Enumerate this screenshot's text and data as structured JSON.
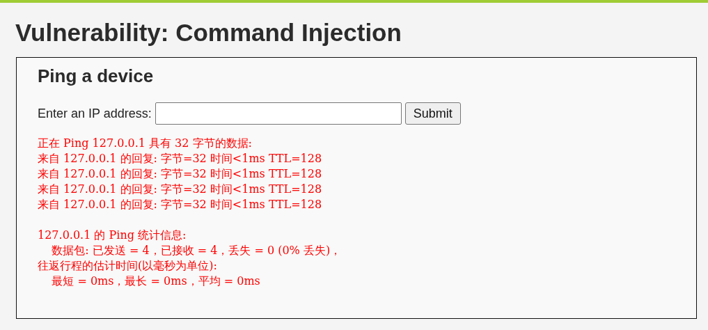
{
  "page": {
    "title": "Vulnerability: Command Injection"
  },
  "panel": {
    "heading": "Ping a device",
    "form": {
      "label": "Enter an IP address:",
      "submit": "Submit"
    },
    "output_blocks": [
      [
        "正在 Ping 127.0.0.1 具有 32 字节的数据:",
        "来自 127.0.0.1 的回复: 字节=32 时间<1ms TTL=128",
        "来自 127.0.0.1 的回复: 字节=32 时间<1ms TTL=128",
        "来自 127.0.0.1 的回复: 字节=32 时间<1ms TTL=128",
        "来自 127.0.0.1 的回复: 字节=32 时间<1ms TTL=128"
      ],
      [
        "127.0.0.1 的 Ping 统计信息:",
        "    数据包: 已发送 = 4，已接收 = 4，丢失 = 0 (0% 丢失)，",
        "往返行程的估计时间(以毫秒为单位):",
        "    最短 = 0ms，最长 = 0ms，平均 = 0ms"
      ]
    ]
  }
}
